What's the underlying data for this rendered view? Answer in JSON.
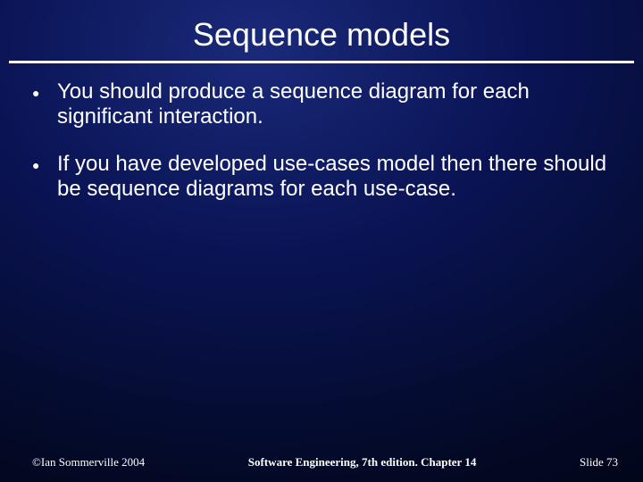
{
  "title": "Sequence models",
  "bullets": [
    "You should produce a sequence diagram for each significant interaction.",
    "If you have developed use-cases model then there should be sequence diagrams for each use-case."
  ],
  "footer": {
    "left": "©Ian Sommerville 2004",
    "center": "Software Engineering, 7th edition. Chapter 14",
    "right": "Slide 73"
  }
}
